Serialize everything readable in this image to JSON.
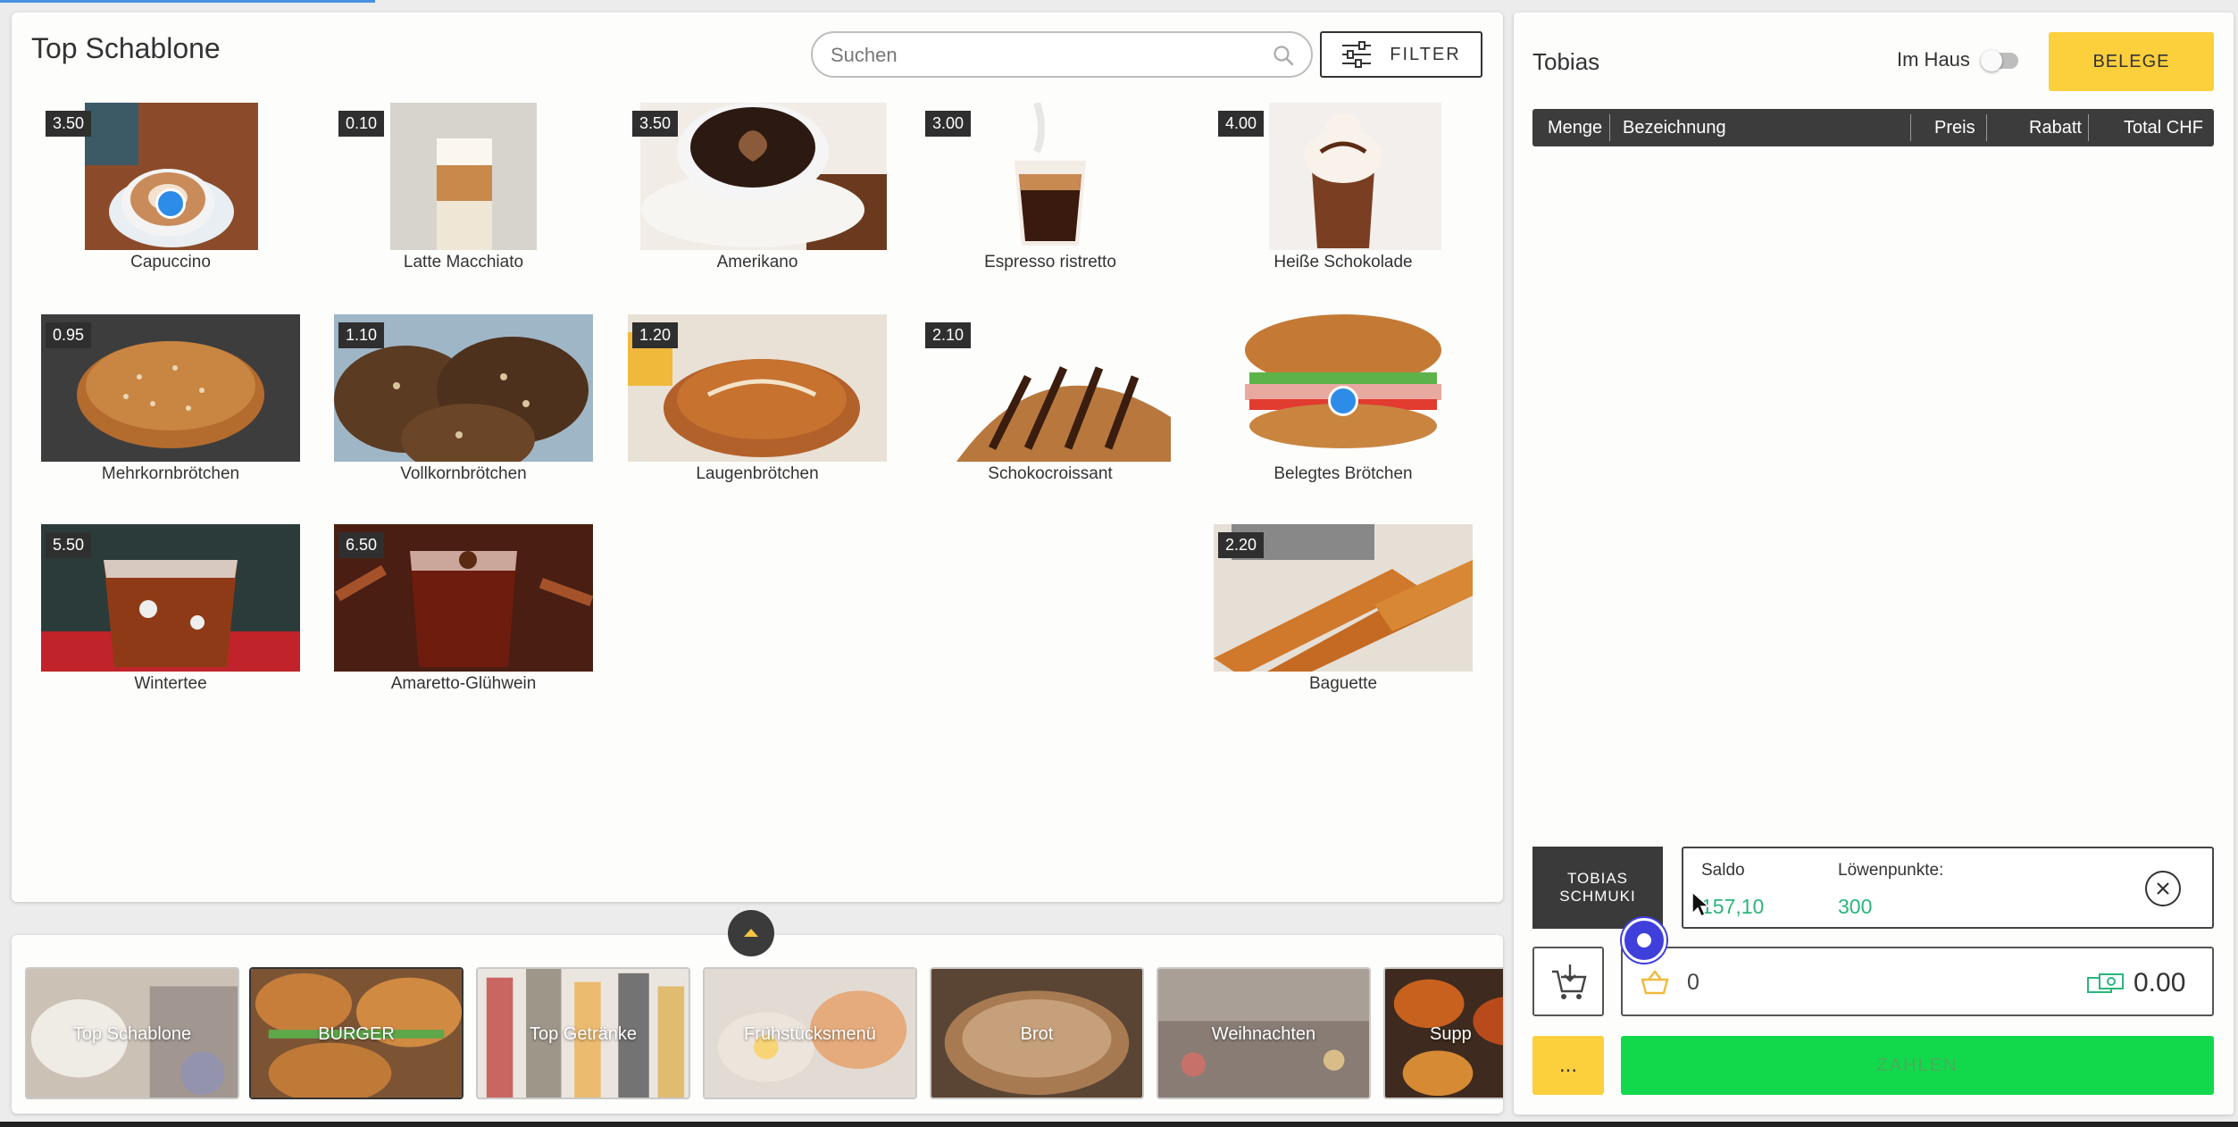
{
  "header": {
    "title": "Top Schablone",
    "search_placeholder": "Suchen",
    "filter_label": "FILTER"
  },
  "products": [
    {
      "name": "Capuccino",
      "price": "3.50"
    },
    {
      "name": "Latte Macchiato",
      "price": "0.10"
    },
    {
      "name": "Amerikano",
      "price": "3.50"
    },
    {
      "name": "Espresso ristretto",
      "price": "3.00"
    },
    {
      "name": "Heiße Schokolade",
      "price": "4.00"
    },
    {
      "name": "Mehrkornbrötchen",
      "price": "0.95"
    },
    {
      "name": "Vollkornbrötchen",
      "price": "1.10"
    },
    {
      "name": "Laugenbrötchen",
      "price": "1.20"
    },
    {
      "name": "Schokocroissant",
      "price": "2.10"
    },
    {
      "name": "Belegtes Brötchen",
      "price": ""
    },
    {
      "name": "Wintertee",
      "price": "5.50"
    },
    {
      "name": "Amaretto-Glühwein",
      "price": "6.50"
    },
    {
      "name": "Baguette",
      "price": "2.20"
    }
  ],
  "categories": [
    {
      "label": "Top Schablone"
    },
    {
      "label": "BURGER"
    },
    {
      "label": "Top Getränke"
    },
    {
      "label": "Frühstücksmenü"
    },
    {
      "label": "Brot"
    },
    {
      "label": "Weihnachten"
    },
    {
      "label": "Supp"
    }
  ],
  "order": {
    "customer": "Tobias",
    "im_haus_label": "Im Haus",
    "belege_label": "BELEGE",
    "columns": {
      "menge": "Menge",
      "bezeichnung": "Bezeichnung",
      "preis": "Preis",
      "rabatt": "Rabatt",
      "total": "Total CHF"
    }
  },
  "customer_card": {
    "name_line1": "TOBIAS",
    "name_line2": "SCHMUKI",
    "saldo_label": "Saldo",
    "saldo_value": "157,10",
    "punkte_label": "Löwenpunkte:",
    "punkte_value": "300"
  },
  "totals": {
    "item_count": "0",
    "amount": "0.00"
  },
  "actions": {
    "more_label": "...",
    "pay_label": "ZAHLEN"
  },
  "colors": {
    "accent_yellow": "#fccf3c",
    "pay_green": "#11d94b",
    "saldo_green": "#2bb57a",
    "header_dark": "#3c3c3c"
  }
}
